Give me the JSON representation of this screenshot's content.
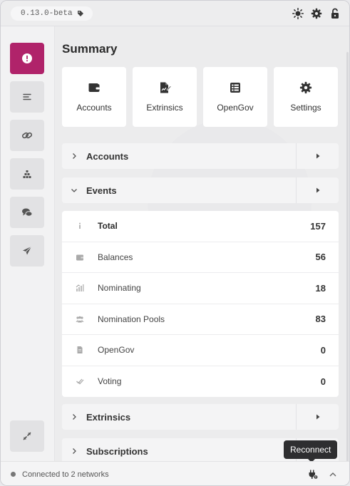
{
  "app": {
    "version": "0.13.0-beta",
    "accent_color": "#b0236a"
  },
  "topbar": {
    "icons": [
      "sun-icon",
      "gear-icon",
      "unlock-icon"
    ]
  },
  "sidebar": {
    "items": [
      {
        "name": "summary",
        "icon": "alert-circle-icon",
        "active": true
      },
      {
        "name": "events-list",
        "icon": "list-icon"
      },
      {
        "name": "chains",
        "icon": "link-icon"
      },
      {
        "name": "network",
        "icon": "cubes-icon"
      },
      {
        "name": "messages",
        "icon": "comments-icon"
      },
      {
        "name": "send",
        "icon": "paper-plane-icon"
      }
    ],
    "bottom_icon": "expand-icon"
  },
  "main": {
    "title": "Summary",
    "cards": [
      {
        "label": "Accounts",
        "icon": "wallet-icon"
      },
      {
        "label": "Extrinsics",
        "icon": "file-signature-icon"
      },
      {
        "label": "OpenGov",
        "icon": "table-list-icon"
      },
      {
        "label": "Settings",
        "icon": "gear-icon"
      }
    ],
    "sections": {
      "accounts": "Accounts",
      "events": "Events",
      "extrinsics": "Extrinsics",
      "subscriptions": "Subscriptions"
    },
    "events": [
      {
        "name": "Total",
        "count": "157",
        "icon": "info-icon",
        "bold": true
      },
      {
        "name": "Balances",
        "count": "56",
        "icon": "wallet-icon"
      },
      {
        "name": "Nominating",
        "count": "18",
        "icon": "chart-icon"
      },
      {
        "name": "Nomination Pools",
        "count": "83",
        "icon": "users-icon"
      },
      {
        "name": "OpenGov",
        "count": "0",
        "icon": "document-icon"
      },
      {
        "name": "Voting",
        "count": "0",
        "icon": "check-double-icon"
      }
    ]
  },
  "tooltip": {
    "text": "Reconnect"
  },
  "statusbar": {
    "text": "Connected to 2 networks"
  }
}
